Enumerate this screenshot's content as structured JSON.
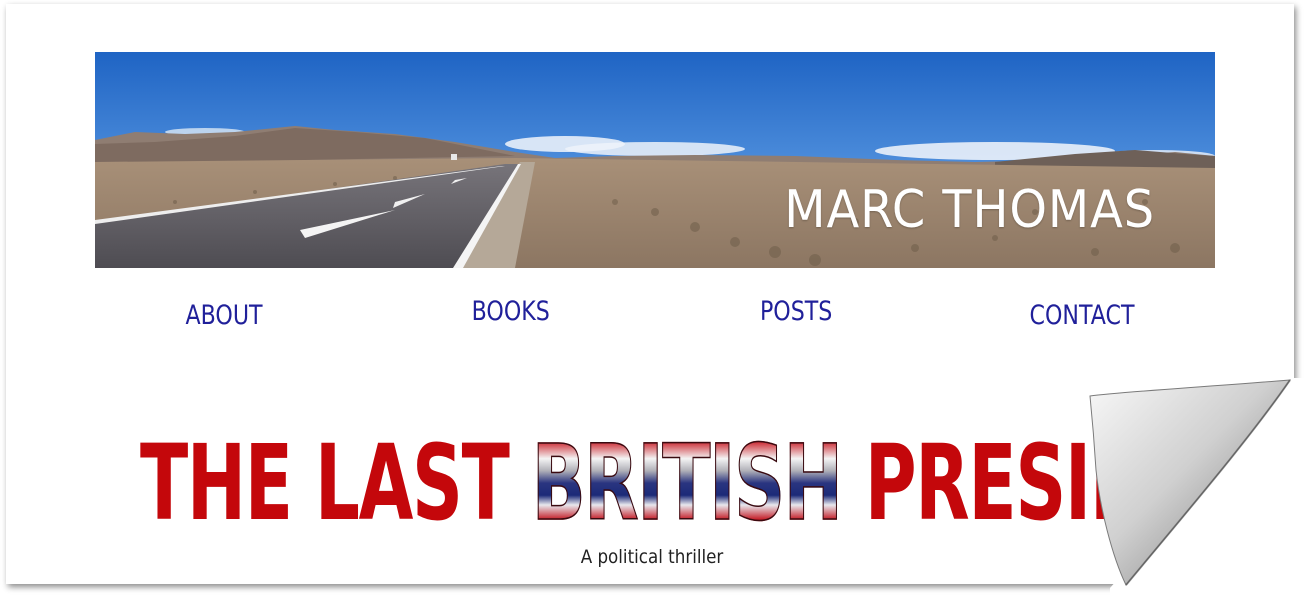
{
  "header": {
    "site_title": "MARC THOMAS"
  },
  "nav": {
    "items": [
      {
        "label": "ABOUT"
      },
      {
        "label": "BOOKS"
      },
      {
        "label": "POSTS"
      },
      {
        "label": "CONTACT"
      }
    ],
    "color": "#20209a"
  },
  "featured_book": {
    "title_part1": "THE LAST ",
    "title_part2": "BRITISH",
    "title_part3": " PRESIDENT",
    "tagline": "A political thriller",
    "title_color": "#c4070b"
  }
}
